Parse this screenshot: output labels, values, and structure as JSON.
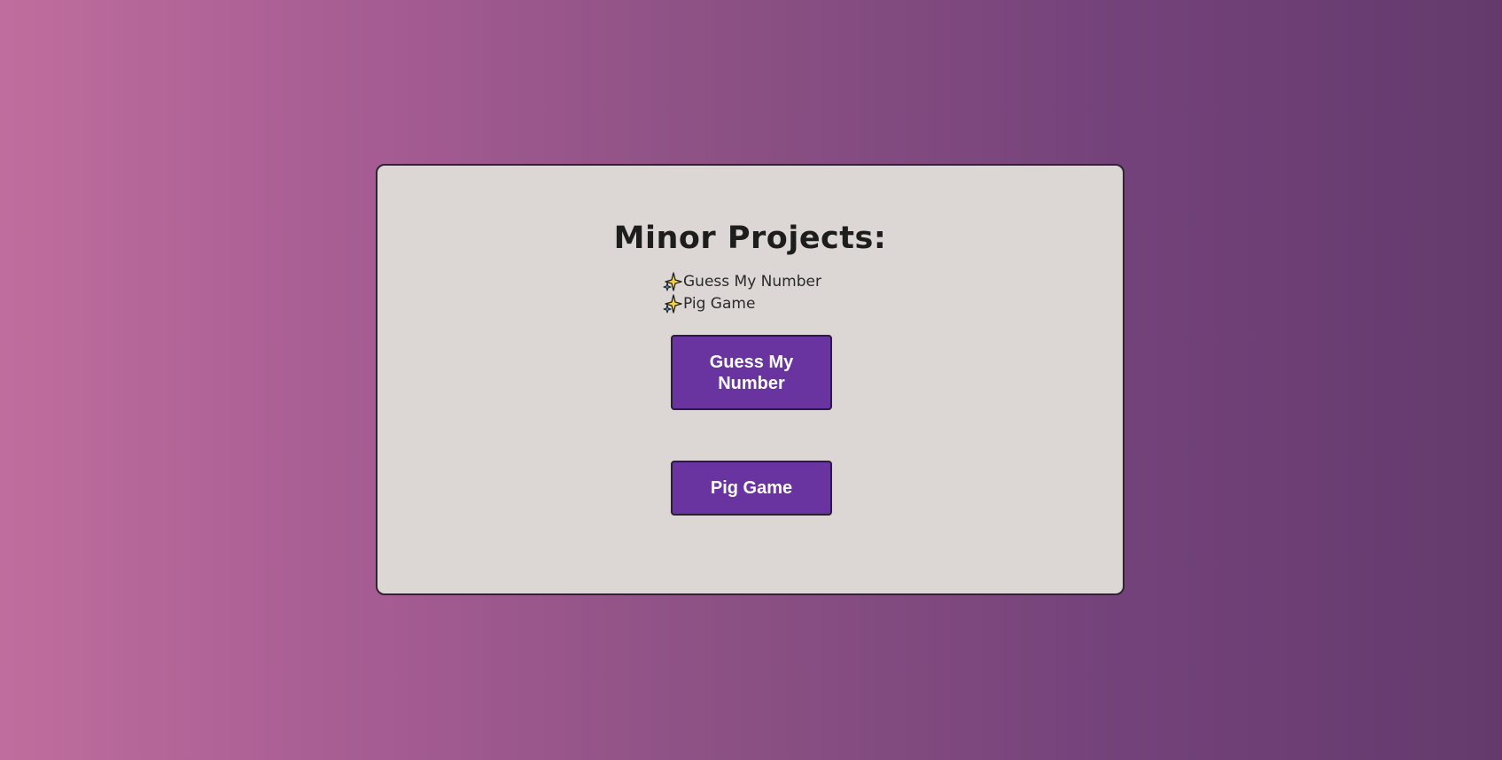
{
  "card": {
    "title": "Minor Projects:",
    "list_items": [
      {
        "icon": "sparkles-icon",
        "label": "Guess My Number"
      },
      {
        "icon": "sparkles-icon",
        "label": "Pig Game"
      }
    ],
    "buttons": {
      "guess_label": "Guess My Number",
      "pig_label": "Pig Game"
    }
  },
  "colors": {
    "background_start": "#bf6d9d",
    "background_end": "#643a6c",
    "card_background": "#dcd7d4",
    "button_fill": "#6a34a0",
    "button_text": "#ffffff"
  }
}
